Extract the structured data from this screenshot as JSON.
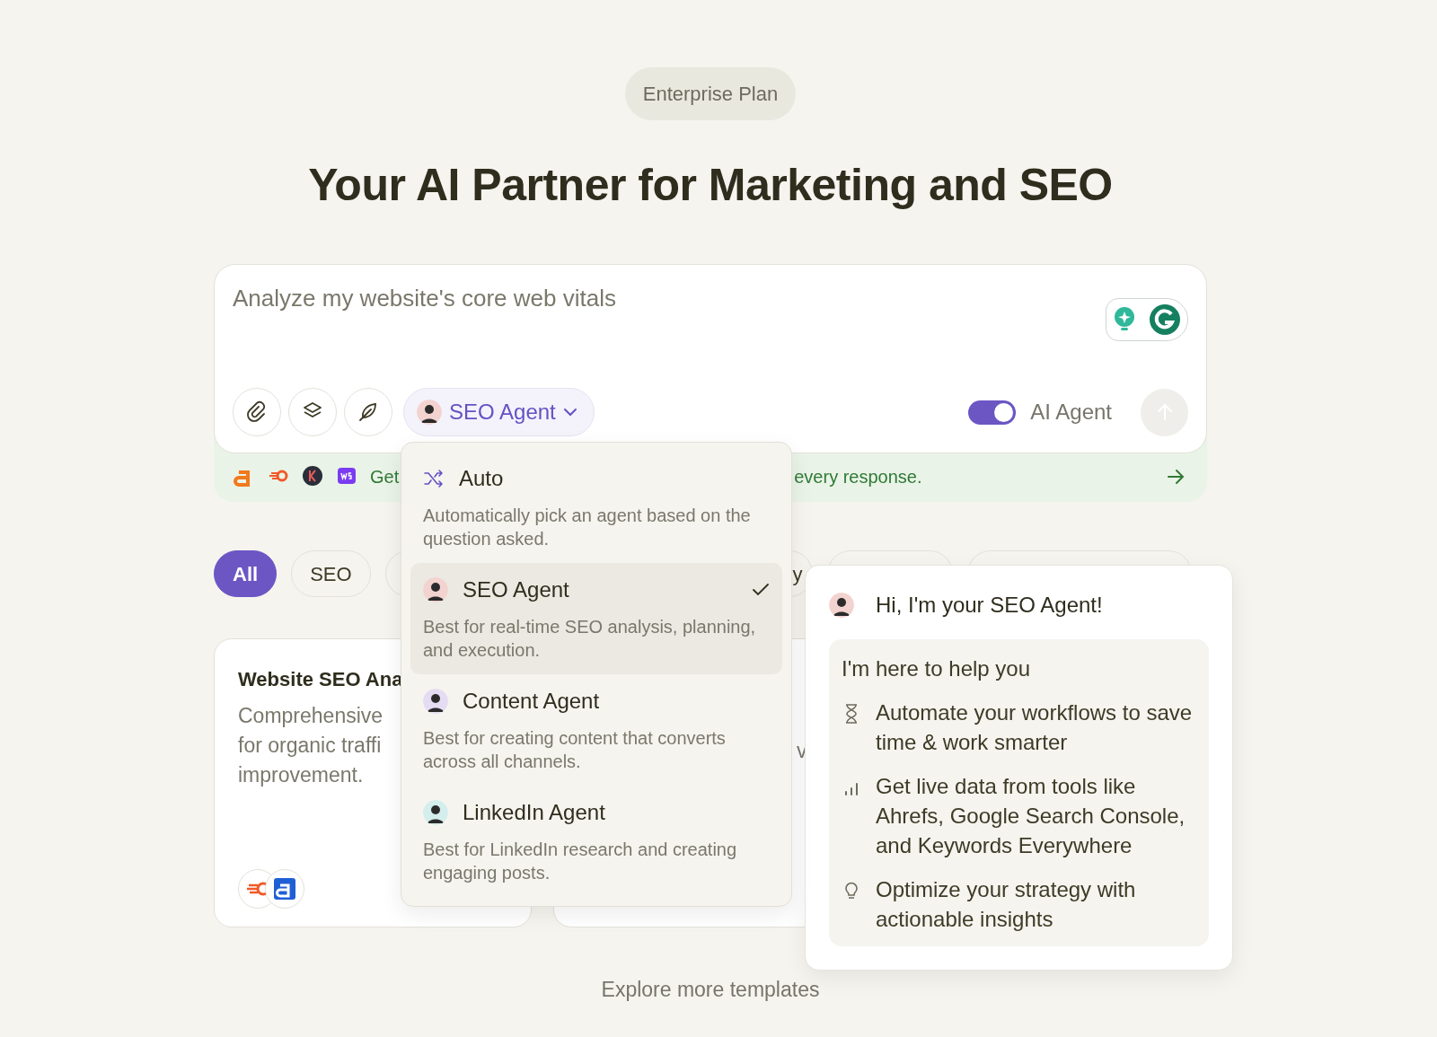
{
  "plan_badge": "Enterprise Plan",
  "heading": "Your AI Partner for Marketing and SEO",
  "composer": {
    "placeholder": "Analyze my website's core web vitals",
    "agent_button": "SEO Agent",
    "ai_agent": {
      "label": "AI Agent",
      "on": true
    },
    "send": {
      "disabled": true
    }
  },
  "banner": {
    "text_start": "Get",
    "text_end": "every response."
  },
  "filters": [
    {
      "label": "All",
      "selected": true
    },
    {
      "label": "SEO",
      "selected": false
    },
    {
      "selected": false
    },
    {
      "label": "y",
      "selected": false
    },
    {
      "selected": false
    },
    {
      "selected": false
    }
  ],
  "templates": [
    {
      "title": "Website SEO Ana",
      "description_lines": [
        "Comprehensive",
        "for organic traffi",
        "improvement."
      ]
    },
    {
      "description_lines": [
        "v"
      ]
    }
  ],
  "agent_menu": [
    {
      "kind": "auto",
      "name": "Auto",
      "description": "Automatically pick an agent based on the question asked.",
      "selected": false
    },
    {
      "kind": "agent",
      "name": "SEO Agent",
      "description": "Best for real-time SEO analysis, planning, and execution.",
      "selected": true,
      "color": "#f3d3cf"
    },
    {
      "kind": "agent",
      "name": "Content Agent",
      "description": "Best for creating content that converts across all channels.",
      "selected": false,
      "color": "#e4dcf3"
    },
    {
      "kind": "agent",
      "name": "LinkedIn Agent",
      "description": "Best for LinkedIn research and creating engaging posts.",
      "selected": false,
      "color": "#d4eeee"
    }
  ],
  "assistant_card": {
    "greeting": "Hi, I'm your SEO Agent!",
    "intro": "I'm here to help you",
    "points": [
      {
        "kind": "hourglass",
        "text": "Automate your workflows to save time & work smarter"
      },
      {
        "kind": "chart",
        "text": "Get live data from tools like Ahrefs, Google Search Console, and Keywords Everywhere"
      },
      {
        "kind": "bulb",
        "text": "Optimize your strategy with actionable insights"
      }
    ]
  },
  "explore_link": "Explore more templates"
}
